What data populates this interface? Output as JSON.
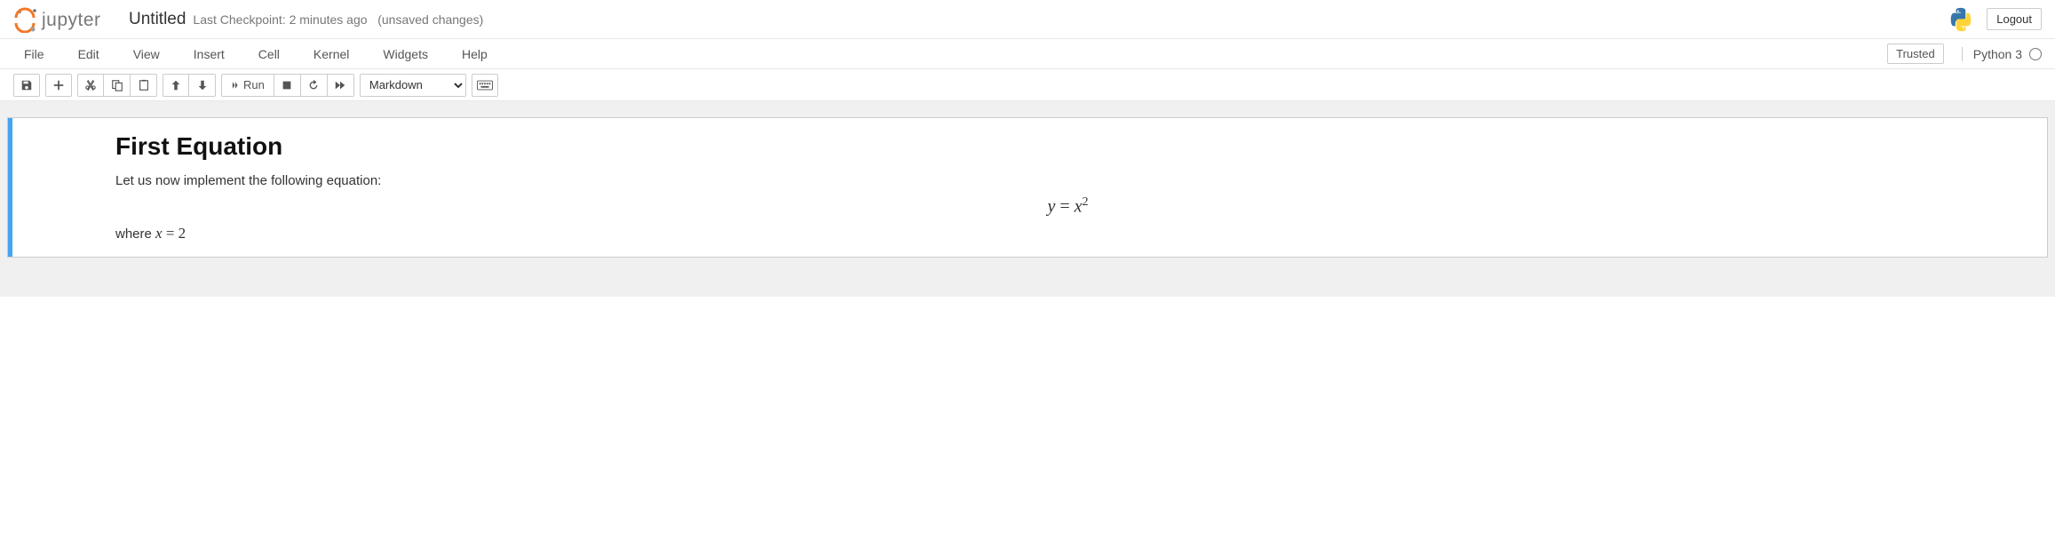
{
  "header": {
    "notebook_name": "Untitled",
    "checkpoint_prefix": "Last Checkpoint: ",
    "checkpoint_time": "2 minutes ago",
    "unsaved": "(unsaved changes)",
    "logout_label": "Logout"
  },
  "menubar": {
    "items": [
      "File",
      "Edit",
      "View",
      "Insert",
      "Cell",
      "Kernel",
      "Widgets",
      "Help"
    ],
    "trusted_label": "Trusted",
    "kernel_label": "Python 3"
  },
  "toolbar": {
    "save_title": "Save and Checkpoint",
    "add_title": "Insert cell below",
    "cut_title": "Cut",
    "copy_title": "Copy",
    "paste_title": "Paste",
    "up_title": "Move up",
    "down_title": "Move down",
    "run_label": "Run",
    "stop_title": "Interrupt",
    "restart_title": "Restart",
    "fastfwd_title": "Restart & Run All",
    "celltype_value": "Markdown",
    "palette_title": "Command Palette"
  },
  "cell": {
    "heading": "First Equation",
    "intro": "Let us now implement the following equation:",
    "equation_lhs": "y",
    "equation_eq": " = ",
    "equation_rhs_base": "x",
    "equation_rhs_exp": "2",
    "where_prefix": "where ",
    "where_var": "x",
    "where_eq": " = ",
    "where_val": "2"
  }
}
